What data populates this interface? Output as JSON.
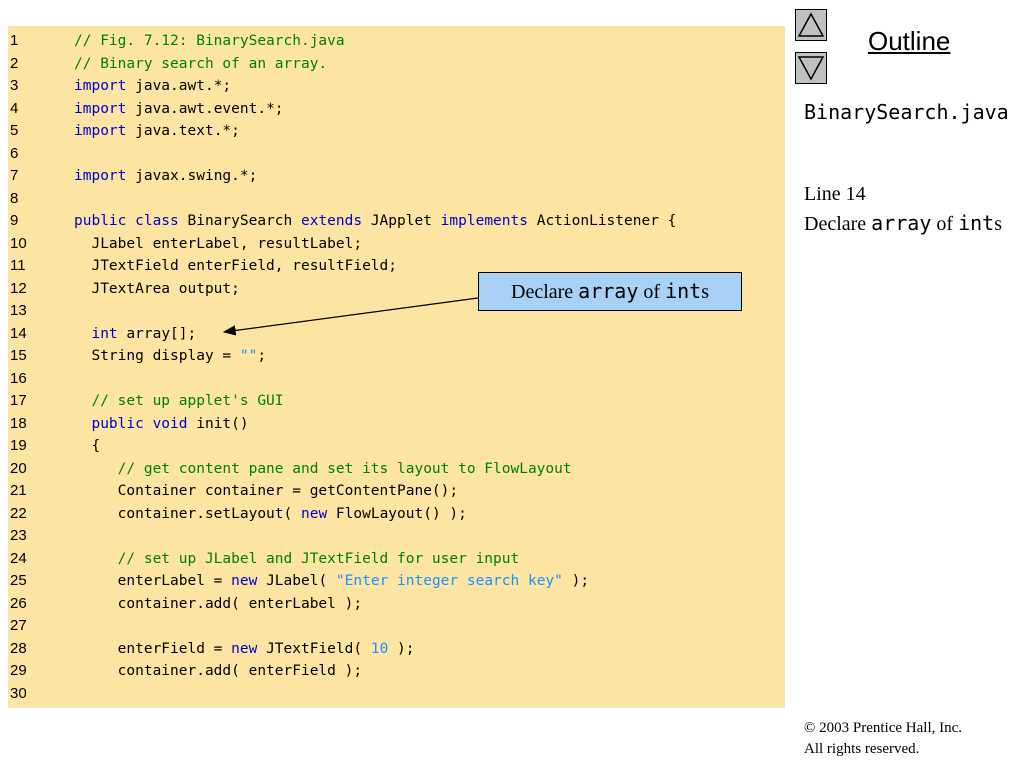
{
  "nav": {
    "up_icon": "triangle-up-icon",
    "down_icon": "triangle-down-icon",
    "outline_label": "Outline"
  },
  "sidebar": {
    "file_title": "BinarySearch.java",
    "note_line": "Line 14",
    "note_desc": {
      "prefix": "Declare ",
      "code1": "array",
      "middle": " of ",
      "code2": "int",
      "suffix": "s"
    }
  },
  "callout": {
    "prefix": "Declare ",
    "code1": "array",
    "middle": " of ",
    "code2": "int",
    "suffix": "s"
  },
  "footer": {
    "copyright_line1": "© 2003 Prentice Hall, Inc.",
    "copyright_line2": "All rights reserved."
  },
  "code": [
    {
      "num": "1",
      "tokens": [
        {
          "t": "// Fig. 7.12: BinarySearch.java",
          "k": "comment"
        }
      ]
    },
    {
      "num": "2",
      "tokens": [
        {
          "t": "// Binary search of an array.",
          "k": "comment"
        }
      ]
    },
    {
      "num": "3",
      "tokens": [
        {
          "t": "import",
          "k": "keyword"
        },
        {
          "t": " java.awt.*;",
          "k": "plain"
        }
      ]
    },
    {
      "num": "4",
      "tokens": [
        {
          "t": "import",
          "k": "keyword"
        },
        {
          "t": " java.awt.event.*;",
          "k": "plain"
        }
      ]
    },
    {
      "num": "5",
      "tokens": [
        {
          "t": "import",
          "k": "keyword"
        },
        {
          "t": " java.text.*;",
          "k": "plain"
        }
      ]
    },
    {
      "num": "6",
      "tokens": []
    },
    {
      "num": "7",
      "tokens": [
        {
          "t": "import",
          "k": "keyword"
        },
        {
          "t": " javax.swing.*;",
          "k": "plain"
        }
      ]
    },
    {
      "num": "8",
      "tokens": []
    },
    {
      "num": "9",
      "tokens": [
        {
          "t": "public class",
          "k": "keyword"
        },
        {
          "t": " BinarySearch ",
          "k": "plain"
        },
        {
          "t": "extends",
          "k": "keyword"
        },
        {
          "t": " JApplet ",
          "k": "plain"
        },
        {
          "t": "implements",
          "k": "keyword"
        },
        {
          "t": " ActionListener {",
          "k": "plain"
        }
      ]
    },
    {
      "num": "10",
      "tokens": [
        {
          "t": "  JLabel enterLabel, resultLabel;",
          "k": "plain"
        }
      ]
    },
    {
      "num": "11",
      "tokens": [
        {
          "t": "  JTextField enterField, resultField;",
          "k": "plain"
        }
      ]
    },
    {
      "num": "12",
      "tokens": [
        {
          "t": "  JTextArea output;",
          "k": "plain"
        }
      ]
    },
    {
      "num": "13",
      "tokens": []
    },
    {
      "num": "14",
      "tokens": [
        {
          "t": "  ",
          "k": "plain"
        },
        {
          "t": "int",
          "k": "keyword"
        },
        {
          "t": " array[];",
          "k": "plain"
        }
      ]
    },
    {
      "num": "15",
      "tokens": [
        {
          "t": "  String display = ",
          "k": "plain"
        },
        {
          "t": "\"\"",
          "k": "string"
        },
        {
          "t": ";",
          "k": "plain"
        }
      ]
    },
    {
      "num": "16",
      "tokens": []
    },
    {
      "num": "17",
      "tokens": [
        {
          "t": "  // set up applet's GUI",
          "k": "comment"
        }
      ]
    },
    {
      "num": "18",
      "tokens": [
        {
          "t": "  ",
          "k": "plain"
        },
        {
          "t": "public void",
          "k": "keyword"
        },
        {
          "t": " init()",
          "k": "plain"
        }
      ]
    },
    {
      "num": "19",
      "tokens": [
        {
          "t": "  {",
          "k": "plain"
        }
      ]
    },
    {
      "num": "20",
      "tokens": [
        {
          "t": "     // get content pane and set its layout to FlowLayout",
          "k": "comment"
        }
      ]
    },
    {
      "num": "21",
      "tokens": [
        {
          "t": "     Container container = getContentPane();",
          "k": "plain"
        }
      ]
    },
    {
      "num": "22",
      "tokens": [
        {
          "t": "     container.setLayout( ",
          "k": "plain"
        },
        {
          "t": "new",
          "k": "keyword"
        },
        {
          "t": " FlowLayout() );",
          "k": "plain"
        }
      ]
    },
    {
      "num": "23",
      "tokens": []
    },
    {
      "num": "24",
      "tokens": [
        {
          "t": "     // set up JLabel and JTextField for user input",
          "k": "comment"
        }
      ]
    },
    {
      "num": "25",
      "tokens": [
        {
          "t": "     enterLabel = ",
          "k": "plain"
        },
        {
          "t": "new",
          "k": "keyword"
        },
        {
          "t": " JLabel( ",
          "k": "plain"
        },
        {
          "t": "\"Enter integer search key\"",
          "k": "string"
        },
        {
          "t": " );",
          "k": "plain"
        }
      ]
    },
    {
      "num": "26",
      "tokens": [
        {
          "t": "     container.add( enterLabel );",
          "k": "plain"
        }
      ]
    },
    {
      "num": "27",
      "tokens": []
    },
    {
      "num": "28",
      "tokens": [
        {
          "t": "     enterField = ",
          "k": "plain"
        },
        {
          "t": "new",
          "k": "keyword"
        },
        {
          "t": " JTextField( ",
          "k": "plain"
        },
        {
          "t": "10",
          "k": "number"
        },
        {
          "t": " );",
          "k": "plain"
        }
      ]
    },
    {
      "num": "29",
      "tokens": [
        {
          "t": "     container.add( enterField );",
          "k": "plain"
        }
      ]
    },
    {
      "num": "30",
      "tokens": []
    }
  ]
}
